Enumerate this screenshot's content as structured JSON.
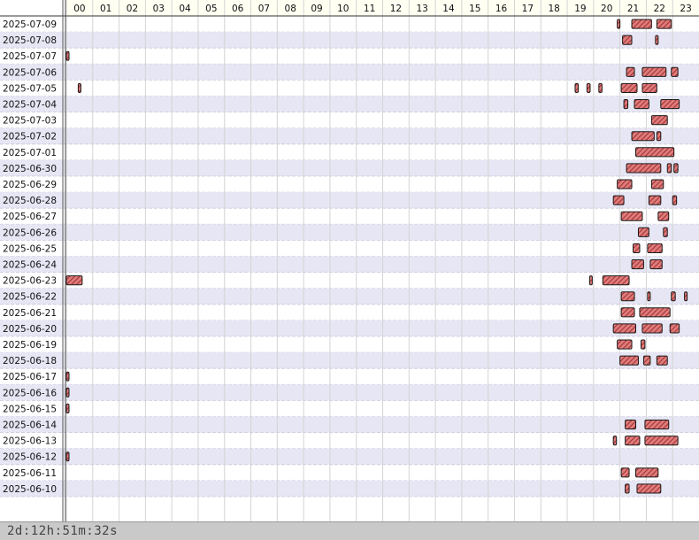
{
  "chart_data": {
    "type": "timeline",
    "x_unit": "hour of day",
    "xlim": [
      0,
      24
    ],
    "hour_labels": [
      "00",
      "01",
      "02",
      "03",
      "04",
      "05",
      "06",
      "07",
      "08",
      "09",
      "10",
      "11",
      "12",
      "13",
      "14",
      "15",
      "16",
      "17",
      "18",
      "19",
      "20",
      "21",
      "22",
      "23"
    ],
    "rows": [
      {
        "date": "2025-07-09",
        "intervals": [
          [
            20.9,
            21.0
          ],
          [
            21.45,
            22.2
          ],
          [
            22.4,
            22.95
          ]
        ]
      },
      {
        "date": "2025-07-08",
        "intervals": [
          [
            21.1,
            21.45
          ],
          [
            22.35,
            22.45
          ]
        ]
      },
      {
        "date": "2025-07-07",
        "intervals": [
          [
            0.0,
            0.08
          ]
        ]
      },
      {
        "date": "2025-07-06",
        "intervals": [
          [
            21.25,
            21.55
          ],
          [
            21.85,
            22.75
          ],
          [
            22.95,
            23.2
          ]
        ]
      },
      {
        "date": "2025-07-05",
        "intervals": [
          [
            0.45,
            0.52
          ],
          [
            19.3,
            19.42
          ],
          [
            19.75,
            19.87
          ],
          [
            20.2,
            20.32
          ],
          [
            21.05,
            21.65
          ],
          [
            21.85,
            22.4
          ]
        ]
      },
      {
        "date": "2025-07-04",
        "intervals": [
          [
            21.15,
            21.3
          ],
          [
            21.55,
            22.1
          ],
          [
            22.55,
            23.25
          ]
        ]
      },
      {
        "date": "2025-07-03",
        "intervals": [
          [
            22.2,
            22.8
          ]
        ]
      },
      {
        "date": "2025-07-02",
        "intervals": [
          [
            21.45,
            22.3
          ],
          [
            22.4,
            22.55
          ]
        ]
      },
      {
        "date": "2025-07-01",
        "intervals": [
          [
            21.6,
            23.05
          ]
        ]
      },
      {
        "date": "2025-06-30",
        "intervals": [
          [
            21.25,
            22.55
          ],
          [
            22.8,
            22.95
          ],
          [
            23.05,
            23.2
          ]
        ]
      },
      {
        "date": "2025-06-29",
        "intervals": [
          [
            20.9,
            21.45
          ],
          [
            22.2,
            22.65
          ]
        ]
      },
      {
        "date": "2025-06-28",
        "intervals": [
          [
            20.75,
            21.15
          ],
          [
            22.1,
            22.55
          ],
          [
            23.0,
            23.15
          ]
        ]
      },
      {
        "date": "2025-06-27",
        "intervals": [
          [
            21.05,
            21.85
          ],
          [
            22.45,
            22.85
          ]
        ]
      },
      {
        "date": "2025-06-26",
        "intervals": [
          [
            21.7,
            22.1
          ],
          [
            22.65,
            22.8
          ]
        ]
      },
      {
        "date": "2025-06-25",
        "intervals": [
          [
            21.5,
            21.75
          ],
          [
            22.05,
            22.6
          ]
        ]
      },
      {
        "date": "2025-06-24",
        "intervals": [
          [
            21.45,
            21.9
          ],
          [
            22.15,
            22.6
          ]
        ]
      },
      {
        "date": "2025-06-23",
        "intervals": [
          [
            0.0,
            0.6
          ],
          [
            19.85,
            19.95
          ],
          [
            20.35,
            21.35
          ]
        ]
      },
      {
        "date": "2025-06-22",
        "intervals": [
          [
            21.05,
            21.55
          ],
          [
            22.05,
            22.15
          ],
          [
            22.95,
            23.1
          ],
          [
            23.45,
            23.55
          ]
        ]
      },
      {
        "date": "2025-06-21",
        "intervals": [
          [
            21.05,
            21.55
          ],
          [
            21.75,
            22.9
          ]
        ]
      },
      {
        "date": "2025-06-20",
        "intervals": [
          [
            20.75,
            21.6
          ],
          [
            21.85,
            22.6
          ],
          [
            22.9,
            23.25
          ]
        ]
      },
      {
        "date": "2025-06-19",
        "intervals": [
          [
            20.9,
            21.45
          ],
          [
            21.8,
            21.95
          ]
        ]
      },
      {
        "date": "2025-06-18",
        "intervals": [
          [
            21.0,
            21.7
          ],
          [
            21.9,
            22.15
          ],
          [
            22.4,
            22.8
          ]
        ]
      },
      {
        "date": "2025-06-17",
        "intervals": [
          [
            0.0,
            0.08
          ]
        ]
      },
      {
        "date": "2025-06-16",
        "intervals": [
          [
            0.0,
            0.08
          ]
        ]
      },
      {
        "date": "2025-06-15",
        "intervals": [
          [
            0.0,
            0.08
          ]
        ]
      },
      {
        "date": "2025-06-14",
        "intervals": [
          [
            21.2,
            21.6
          ],
          [
            21.95,
            22.85
          ]
        ]
      },
      {
        "date": "2025-06-13",
        "intervals": [
          [
            20.75,
            20.87
          ],
          [
            21.2,
            21.75
          ],
          [
            21.95,
            23.2
          ]
        ]
      },
      {
        "date": "2025-06-12",
        "intervals": [
          [
            0.0,
            0.08
          ]
        ]
      },
      {
        "date": "2025-06-11",
        "intervals": [
          [
            21.05,
            21.35
          ],
          [
            21.6,
            22.45
          ]
        ]
      },
      {
        "date": "2025-06-10",
        "intervals": [
          [
            21.2,
            21.35
          ],
          [
            21.65,
            22.55
          ]
        ]
      }
    ]
  },
  "footer": {
    "duration": "2d:12h:51m:32s"
  },
  "colors": {
    "bar_fill": "#e07a7a",
    "bar_hatch": "#8a1f1f",
    "row_alt": "#e6e6f4",
    "header_bg": "#fffff2",
    "footer_bg": "#c9c9c9"
  }
}
